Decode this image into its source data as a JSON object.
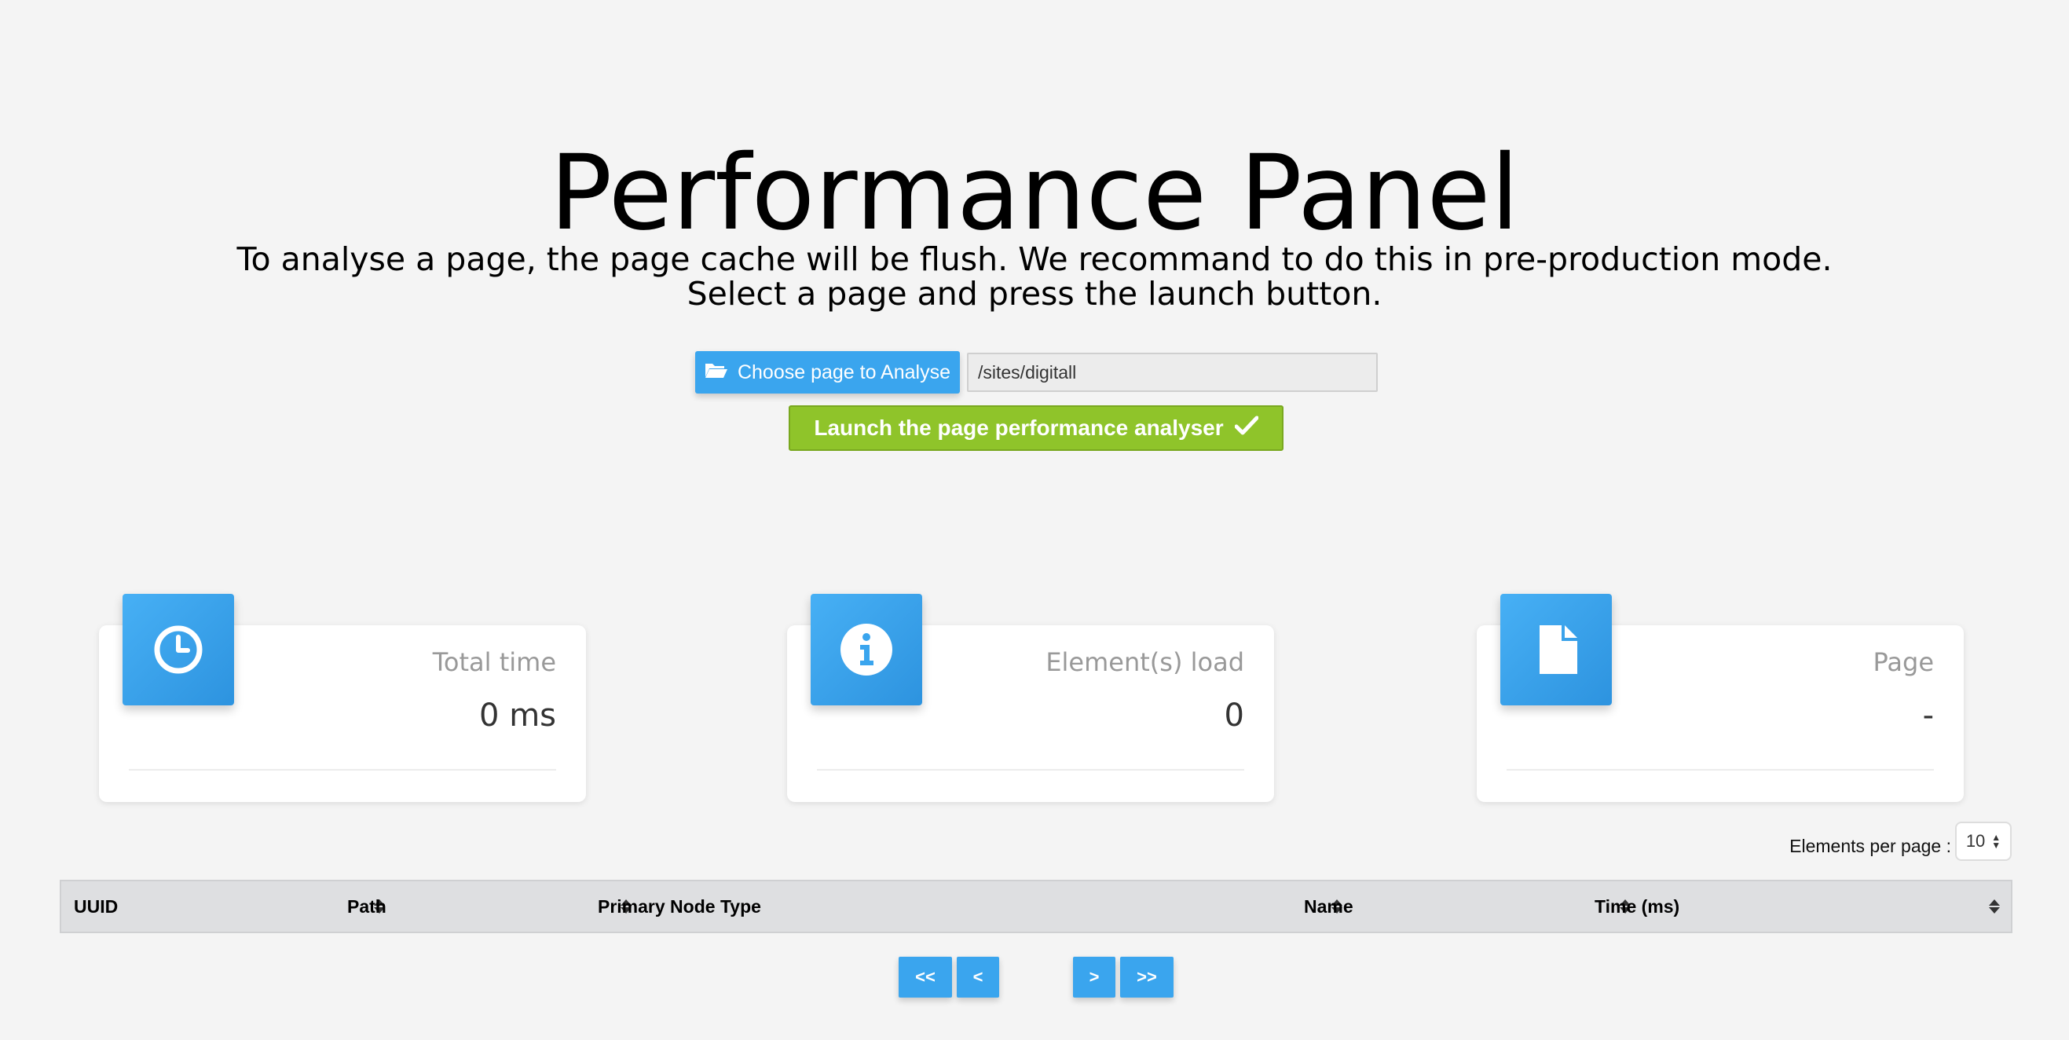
{
  "header": {
    "title": "Performance Panel",
    "subtitle_line1": "To analyse a page, the page cache will be flush. We recommand to do this in pre-production mode.",
    "subtitle_line2": "Select a page and press the launch button."
  },
  "controls": {
    "choose_label": "Choose page to Analyse",
    "choose_icon": "folder-open-icon",
    "path_value": "/sites/digitall",
    "launch_label": "Launch the page performance analyser",
    "launch_icon": "check-icon"
  },
  "cards": [
    {
      "icon": "clock-icon",
      "label": "Total time",
      "value": "0 ms"
    },
    {
      "icon": "info-icon",
      "label": "Element(s) load",
      "value": "0"
    },
    {
      "icon": "file-icon",
      "label": "Page",
      "value": "-"
    }
  ],
  "table": {
    "per_page_label": "Elements per page :",
    "per_page_value": "10",
    "columns": [
      "UUID",
      "Path",
      "Primary Node Type",
      "Name",
      "Time (ms)"
    ]
  },
  "pager": {
    "first": "<<",
    "prev": "<",
    "next": ">",
    "last": ">>"
  },
  "colors": {
    "accent": "#3aa5ee",
    "launch": "#8fc42a",
    "background": "#f4f4f4"
  }
}
